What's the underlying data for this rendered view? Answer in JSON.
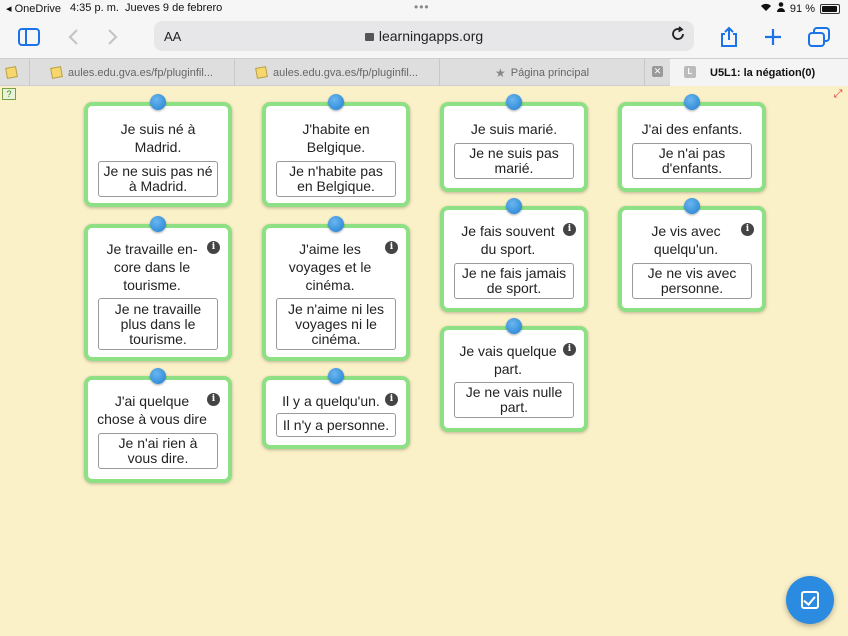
{
  "status_bar": {
    "back_app": "◂ OneDrive",
    "time": "4:35 p. m.",
    "date": "Jueves 9 de febrero",
    "battery": "91 %"
  },
  "toolbar": {
    "text_size": "AA",
    "url": "learningapps.org"
  },
  "tabs": [
    {
      "label": "aules.edu.gva.es/fp/pluginfil..."
    },
    {
      "label": "aules.edu.gva.es/fp/pluginfil..."
    },
    {
      "label": "Página principal"
    },
    {
      "label": "U5L1: la négation(0)"
    }
  ],
  "cards": [
    {
      "question": "Je suis né à Madrid.",
      "answer": "Je ne suis pas né à Madrid.",
      "info": false
    },
    {
      "question": "Je travaille en-core dans le tourisme.",
      "answer": "Je ne travaille plus dans le tourisme.",
      "info": true
    },
    {
      "question": "J'ai quelque chose à vous dire",
      "answer": "Je n'ai rien à vous dire.",
      "info": true
    },
    {
      "question": "J'habite en Belgique.",
      "answer": "Je n'habite pas en Belgique.",
      "info": false
    },
    {
      "question": "J'aime les voyages et le cinéma.",
      "answer": "Je n'aime ni les voyages ni le cinéma.",
      "info": true
    },
    {
      "question": "Il y a quelqu'un.",
      "answer": "Il n'y a personne.",
      "info": true
    },
    {
      "question": "Je suis marié.",
      "answer": "Je ne suis pas marié.",
      "info": false
    },
    {
      "question": "Je fais souvent du sport.",
      "answer": "Je ne fais jamais de sport.",
      "info": true
    },
    {
      "question": "Je vais quelque part.",
      "answer": "Je ne vais nulle part.",
      "info": true
    },
    {
      "question": "J'ai des enfants.",
      "answer": "Je n'ai pas d'enfants.",
      "info": false
    },
    {
      "question": "Je vis avec quelqu'un.",
      "answer": "Je ne vis avec personne.",
      "info": true
    }
  ],
  "icons": {
    "sidebar": "sidebar-icon",
    "back": "back-arrow-icon",
    "forward": "forward-arrow-icon",
    "share": "share-icon",
    "new_tab": "plus-icon",
    "tabs": "tabs-overview-icon",
    "check": "check-answers-icon"
  },
  "colors": {
    "accent": "#1a73e8",
    "card_border": "#8ee085",
    "pin": "#2f8fde",
    "background": "#fbf1c8"
  }
}
